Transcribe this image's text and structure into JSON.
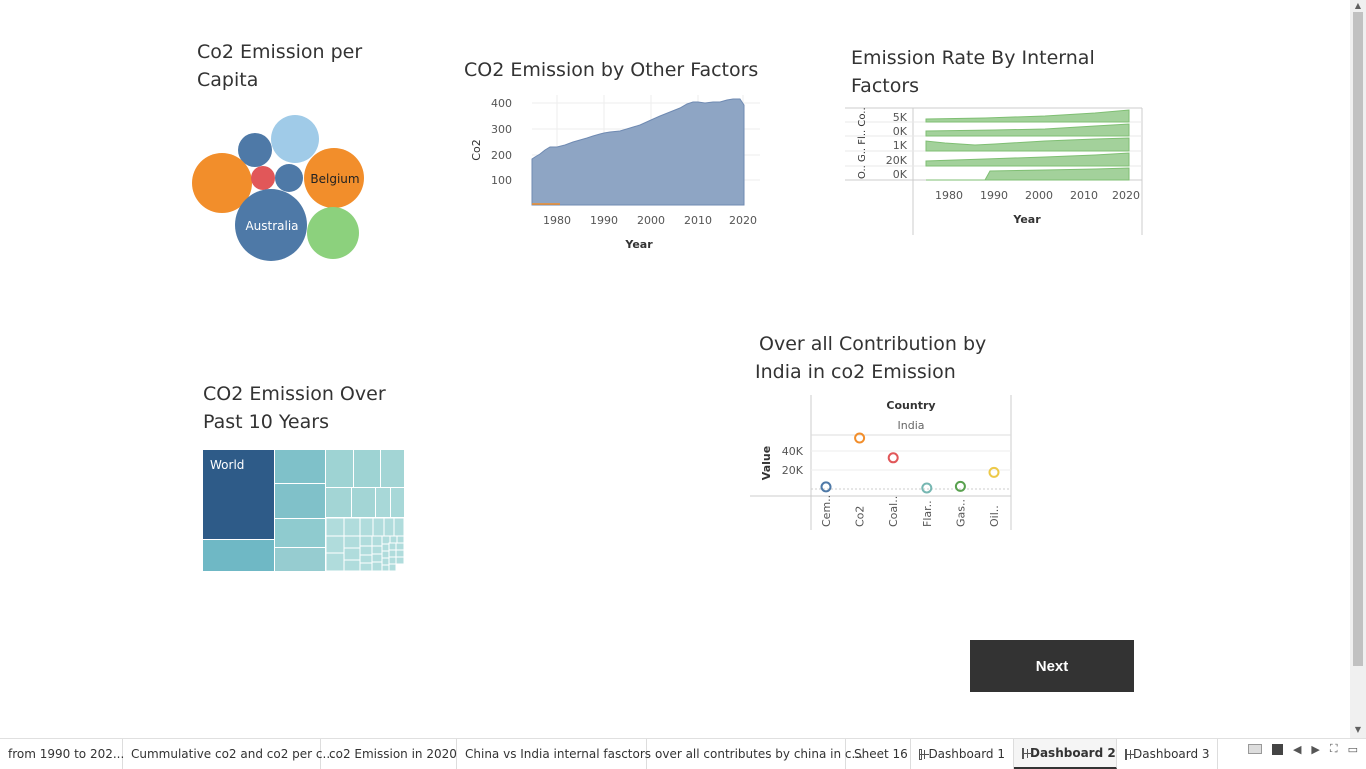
{
  "charts": {
    "per_capita": {
      "title": "Co2 Emission per Capita",
      "labels": {
        "belgium": "Belgium",
        "australia": "Australia"
      }
    },
    "other_factors": {
      "title": "CO2 Emission by Other Factors",
      "ylabel": "Co2",
      "xlabel": "Year",
      "yticks": [
        "400",
        "300",
        "200",
        "100"
      ],
      "xticks": [
        "1980",
        "1990",
        "2000",
        "2010",
        "2020"
      ]
    },
    "internal": {
      "title": "Emission Rate By Internal Factors",
      "xlabel": "Year",
      "row_labels": [
        "5K",
        "0K",
        "1K",
        "20K",
        "0K"
      ],
      "axis_header": "O.. G.. Fl.. Co.. Ce..",
      "xticks": [
        "1980",
        "1990",
        "2000",
        "2010",
        "2020"
      ]
    },
    "past10": {
      "title": "CO2 Emission Over Past 10 Years",
      "world_label": "World"
    },
    "india": {
      "title": "Over all Contribution by India in co2 Emission",
      "header": "Country",
      "country": "India",
      "ylabel": "Value",
      "yticks": [
        "40K",
        "20K"
      ],
      "categories": [
        "Cem..",
        "Co2",
        "Coal..",
        "Flar..",
        "Gas..",
        "Oil.."
      ]
    }
  },
  "chart_data": [
    {
      "type": "scatter",
      "title": "Over all Contribution by India in co2 Emission",
      "categories": [
        "Cem..",
        "Co2",
        "Coal..",
        "Flar..",
        "Gas..",
        "Oil.."
      ],
      "values": [
        2000,
        49000,
        30000,
        1000,
        2500,
        16000
      ],
      "colors": [
        "#4e79a7",
        "#f28e2b",
        "#e15759",
        "#76b7b2",
        "#59a14f",
        "#edc948"
      ],
      "ylabel": "Value",
      "ylim": [
        0,
        50000
      ]
    },
    {
      "type": "area",
      "title": "CO2 Emission by Other Factors",
      "xlabel": "Year",
      "ylabel": "Co2",
      "x": [
        1973,
        1975,
        1980,
        1985,
        1990,
        1995,
        2000,
        2005,
        2008,
        2010,
        2015,
        2019,
        2021
      ],
      "values": [
        185,
        190,
        230,
        240,
        275,
        290,
        330,
        375,
        405,
        400,
        400,
        415,
        405
      ],
      "ylim": [
        0,
        420
      ]
    }
  ],
  "next_button": {
    "label": "Next"
  },
  "tabs": [
    {
      "label": "from 1990 to 202...",
      "dashboard": false
    },
    {
      "label": "Cummulative co2 and co2 per c...",
      "dashboard": false
    },
    {
      "label": "co2 Emission in 2020",
      "dashboard": false
    },
    {
      "label": "China vs India internal fasctors",
      "dashboard": false
    },
    {
      "label": "over all contributes by china in c...",
      "dashboard": false
    },
    {
      "label": "Sheet 16",
      "dashboard": false
    },
    {
      "label": "Dashboard 1",
      "dashboard": true
    },
    {
      "label": "Dashboard 2",
      "dashboard": true
    },
    {
      "label": "Dashboard 3",
      "dashboard": true
    }
  ],
  "active_tab": "Dashboard 2",
  "colors": {
    "tableau_blue": "#4e79a7",
    "tableau_orange": "#f28e2b",
    "area_fill": "#8ea5c4",
    "green_area": "#a3d19b",
    "button_bg": "#333333"
  }
}
